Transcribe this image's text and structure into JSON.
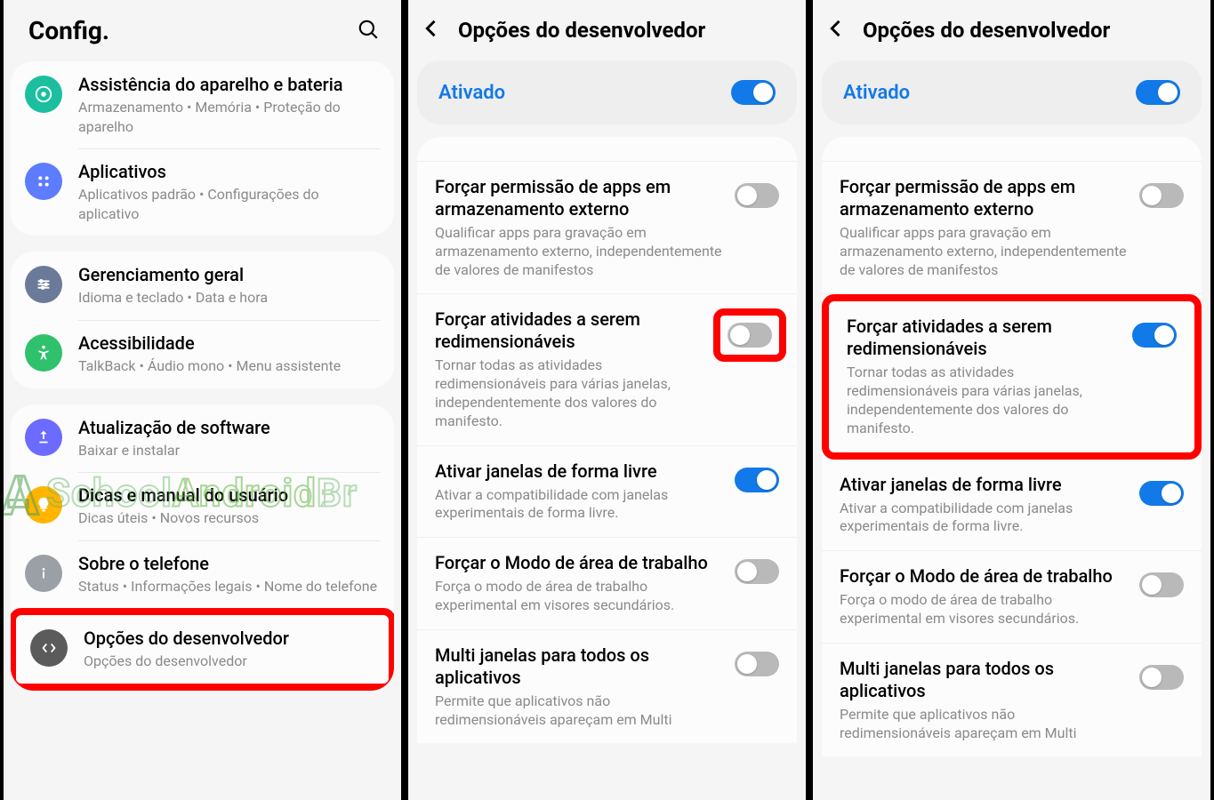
{
  "screen1": {
    "title": "Config.",
    "items": [
      {
        "icon": "device-care",
        "color": "#1bbfa0",
        "title": "Assistência do aparelho e bateria",
        "sub": "Armazenamento  •  Memória  •  Proteção do aparelho"
      },
      {
        "icon": "apps",
        "color": "#5d7cff",
        "title": "Aplicativos",
        "sub": "Aplicativos padrão  •  Configurações do aplicativo"
      },
      {
        "icon": "sliders",
        "color": "#6b7a99",
        "title": "Gerenciamento geral",
        "sub": "Idioma e teclado  •  Data e hora"
      },
      {
        "icon": "accessibility",
        "color": "#2fc16b",
        "title": "Acessibilidade",
        "sub": "TalkBack  •  Áudio mono  •  Menu assistente"
      },
      {
        "icon": "update",
        "color": "#6b6bff",
        "title": "Atualização de software",
        "sub": "Baixar e instalar"
      },
      {
        "icon": "tips",
        "color": "#ffb400",
        "title": "Dicas e manual do usuário",
        "sub": "Dicas úteis  •  Novos recursos"
      },
      {
        "icon": "about",
        "color": "#9aa0a6",
        "title": "Sobre o telefone",
        "sub": "Status  •  Informações legais  •  Nome do telefone"
      },
      {
        "icon": "developer",
        "color": "#5b5b5b",
        "title": "Opções do desenvolvedor",
        "sub": "Opções do desenvolvedor",
        "highlighted": true
      }
    ]
  },
  "devOptions": {
    "headerTitle": "Opções do desenvolvedor",
    "masterLabel": "Ativado",
    "options": [
      {
        "title": "Forçar permissão de apps em armazenamento externo",
        "sub": "Qualificar apps para gravação em armazenamento externo, independentemente de valores de manifestos"
      },
      {
        "title": "Forçar atividades a serem redimensionáveis",
        "sub": "Tornar todas as atividades redimensionáveis para várias janelas, independentemente dos valores do manifesto."
      },
      {
        "title": "Ativar janelas de forma livre",
        "sub": "Ativar a compatibilidade com janelas experimentais de forma livre."
      },
      {
        "title": "Forçar o Modo de área de trabalho",
        "sub": "Força o modo de área de trabalho experimental em visores secundários."
      },
      {
        "title": "Multi janelas para todos os aplicativos",
        "sub": "Permite que aplicativos não redimensionáveis apareçam em Multi"
      }
    ],
    "screen2": {
      "toggleStates": [
        false,
        false,
        true,
        false,
        false
      ],
      "highlightToggleOnly": 1
    },
    "screen3": {
      "toggleStates": [
        false,
        true,
        true,
        false,
        false
      ],
      "highlightRow": 1
    }
  },
  "watermark": {
    "sa": "SA",
    "text1": "School",
    "text2": "Android",
    "text3": "Br"
  }
}
